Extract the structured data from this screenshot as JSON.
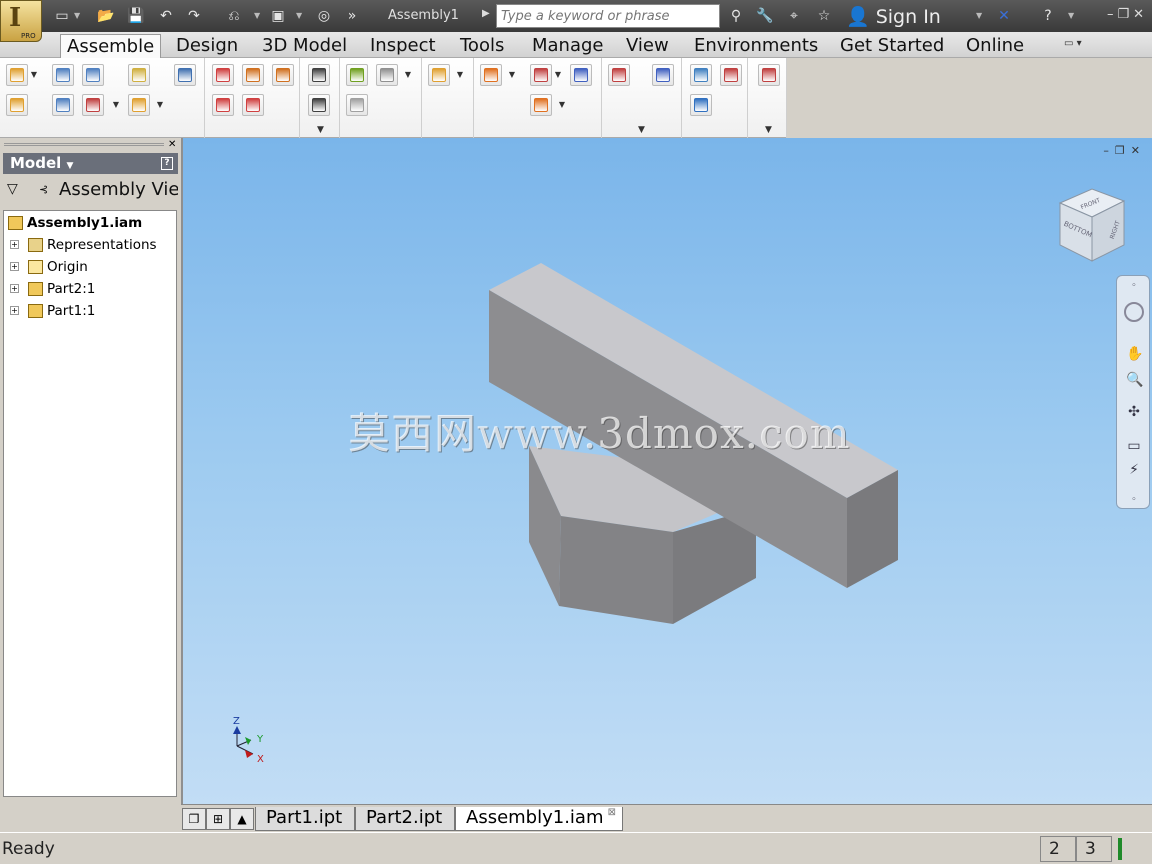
{
  "app": {
    "title": "Assembly1",
    "badge": "PRO"
  },
  "search": {
    "placeholder": "Type a keyword or phrase"
  },
  "account": {
    "signin_label": "Sign In"
  },
  "menu": {
    "tabs": [
      {
        "label": "Assemble",
        "active": true
      },
      {
        "label": "Design"
      },
      {
        "label": "3D Model"
      },
      {
        "label": "Inspect"
      },
      {
        "label": "Tools"
      },
      {
        "label": "Manage"
      },
      {
        "label": "View"
      },
      {
        "label": "Environments"
      },
      {
        "label": "Get Started"
      },
      {
        "label": "Online"
      }
    ]
  },
  "browser": {
    "header": "Model",
    "view_label": "Assembly View",
    "tree": [
      {
        "label": "Assembly1.iam",
        "icon": "assembly-icon",
        "bold": true
      },
      {
        "label": "Representations",
        "icon": "representations-icon"
      },
      {
        "label": "Origin",
        "icon": "folder-icon"
      },
      {
        "label": "Part2:1",
        "icon": "part-icon"
      },
      {
        "label": "Part1:1",
        "icon": "part-icon"
      }
    ]
  },
  "viewport": {
    "watermark": "莫西网www.3dmox.com",
    "viewcube": {
      "face_front": "FRONT",
      "face_bottom": "BOTTOM",
      "face_right": "RIGHT"
    },
    "triad": {
      "x": "X",
      "y": "Y",
      "z": "Z"
    }
  },
  "doc_tabs": [
    {
      "label": "Part1.ipt"
    },
    {
      "label": "Part2.ipt"
    },
    {
      "label": "Assembly1.iam",
      "active": true
    }
  ],
  "status": {
    "text": "Ready",
    "cell1": "2",
    "cell2": "3"
  },
  "colors": {
    "viewport_top": "#7ab5ea",
    "viewport_bottom": "#c2ddf5",
    "part_top": "#c6c6ca",
    "part_front": "#8d8d90",
    "part_side": "#7a7a7d"
  }
}
